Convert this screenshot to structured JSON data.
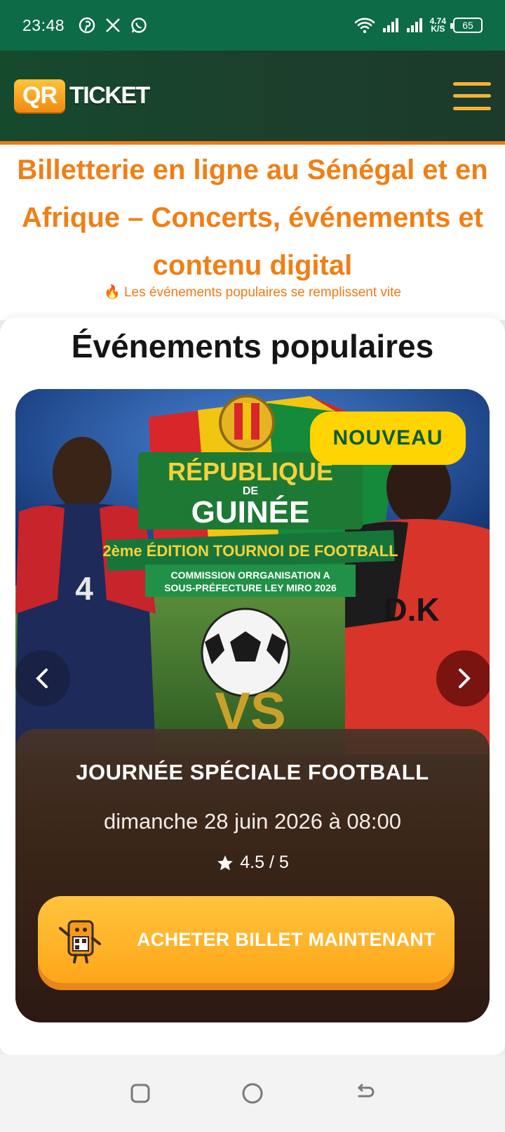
{
  "status_bar": {
    "time": "23:48",
    "net_speed_value": "4.74",
    "net_speed_unit": "K/S",
    "battery": "65",
    "icons": [
      "pinterest-icon",
      "x-icon",
      "whatsapp-icon",
      "wifi-icon",
      "signal-icon",
      "signal-icon",
      "battery-icon"
    ]
  },
  "header": {
    "logo_qr": "QR",
    "logo_ticket": "TICKET",
    "menu_icon": "hamburger-menu-icon",
    "accent_color": "#f07a1a"
  },
  "hero": {
    "title": "Billetterie en ligne au Sénégal et en Afrique – Concerts, événements et contenu digital",
    "subtitle": "🔥 Les événements populaires se remplissent vite"
  },
  "events": {
    "section_title": "Événements populaires",
    "slide": {
      "badge": "NOUVEAU",
      "poster": {
        "line1": "RÉPUBLIQUE",
        "line2": "DE",
        "line3": "GUINÉE",
        "edition": "2ème ÉDITION TOURNOI DE FOOTBALL",
        "commission1": "COMMISSION ORRGANISATION A",
        "commission2": "SOUS-PRÉFECTURE LEY MIRO 2026",
        "vs": "VS",
        "jersey_left": "4",
        "jersey_right": "D.K"
      },
      "title": "JOURNÉE SPÉCIALE FOOTBALL",
      "date": "dimanche 28 juin 2026 à 08:00",
      "rating": "4.5 / 5",
      "buy_label": "ACHETER BILLET MAINTENANT"
    },
    "prev_icon": "chevron-left-icon",
    "next_icon": "chevron-right-icon"
  },
  "navbar": {
    "keys": [
      "recents-square-icon",
      "home-circle-icon",
      "back-arrow-icon"
    ]
  }
}
